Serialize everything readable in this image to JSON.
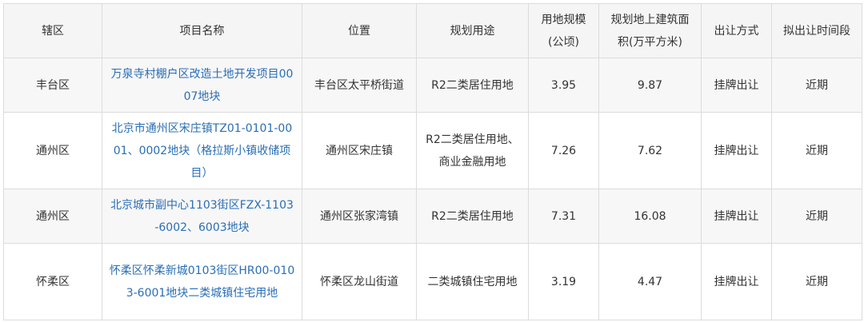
{
  "headers": [
    "辖区",
    "项目名称",
    "位置",
    "规划用途",
    "用地规模(公顷)",
    "规划地上建筑面积(万平方米)",
    "出让方式",
    "拟出让时间段"
  ],
  "rows": [
    {
      "district": "丰台区",
      "project": "万泉寺村棚户区改造土地开发项目0007地块",
      "location": "丰台区太平桥街道",
      "use": "R2二类居住用地",
      "area": "3.95",
      "floor_area": "9.87",
      "method": "挂牌出让",
      "period": "近期"
    },
    {
      "district": "通州区",
      "project": "北京市通州区宋庄镇TZ01-0101-0001、0002地块（格拉斯小镇收储项目）",
      "location": "通州区宋庄镇",
      "use": "R2二类居住用地、商业金融用地",
      "area": "7.26",
      "floor_area": "7.62",
      "method": "挂牌出让",
      "period": "近期"
    },
    {
      "district": "通州区",
      "project": "北京城市副中心1103街区FZX-1103-6002、6003地块",
      "location": "通州区张家湾镇",
      "use": "R2二类居住用地",
      "area": "7.31",
      "floor_area": "16.08",
      "method": "挂牌出让",
      "period": "近期"
    },
    {
      "district": "怀柔区",
      "project": "怀柔区怀柔新城0103街区HR00-0103-6001地块二类城镇住宅用地",
      "location": "怀柔区龙山街道",
      "use": "二类城镇住宅用地",
      "area": "3.19",
      "floor_area": "4.47",
      "method": "挂牌出让",
      "period": "近期"
    }
  ]
}
